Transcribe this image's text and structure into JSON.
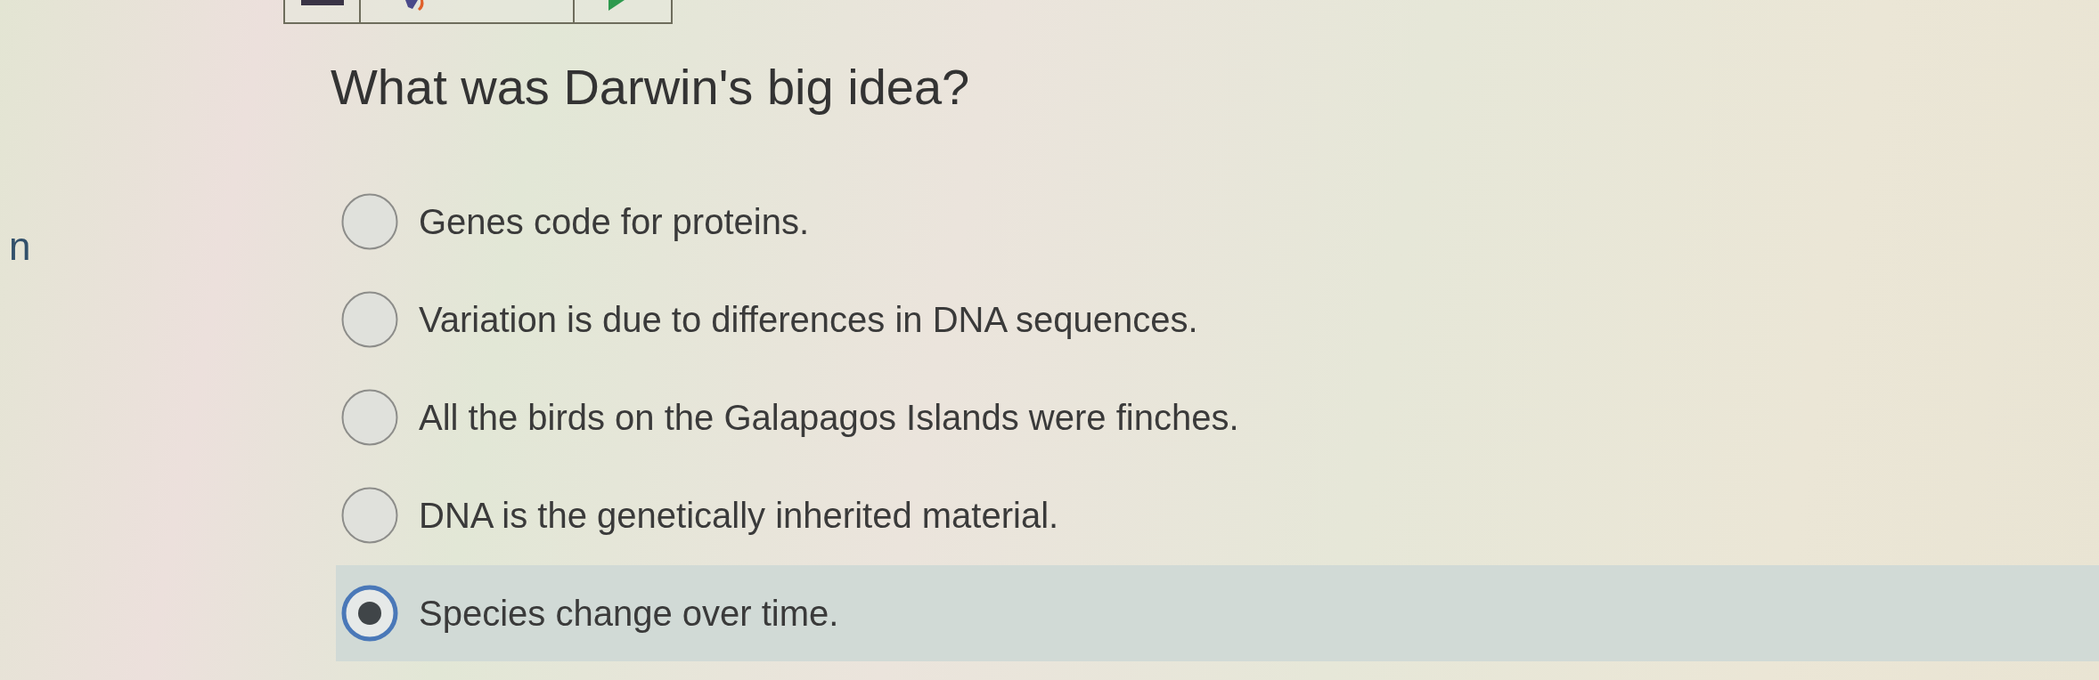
{
  "side_text": "n",
  "question": {
    "title": "What was Darwin's big idea?",
    "options": [
      {
        "label": "Genes code for proteins.",
        "selected": false
      },
      {
        "label": "Variation is due to differences in DNA sequences.",
        "selected": false
      },
      {
        "label": "All the birds on the Galapagos Islands were finches.",
        "selected": false
      },
      {
        "label": "DNA is the genetically inherited material.",
        "selected": false
      },
      {
        "label": "Species change over time.",
        "selected": true
      }
    ]
  }
}
